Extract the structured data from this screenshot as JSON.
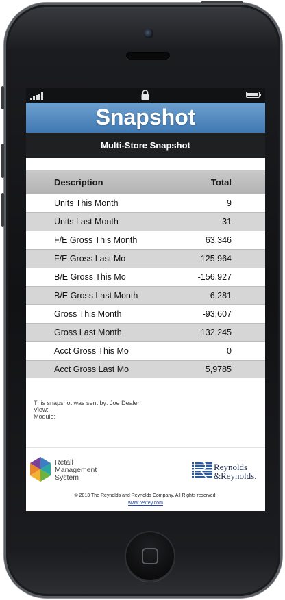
{
  "header": {
    "title": "Snapshot",
    "subtitle": "Multi-Store Snapshot"
  },
  "table": {
    "columns": [
      "Description",
      "Total"
    ],
    "rows": [
      {
        "description": "Units This Month",
        "total": "9"
      },
      {
        "description": "Units Last Month",
        "total": "31"
      },
      {
        "description": "F/E Gross This Month",
        "total": "63,346"
      },
      {
        "description": "F/E Gross Last Mo",
        "total": "125,964"
      },
      {
        "description": "B/E Gross This Mo",
        "total": "-156,927"
      },
      {
        "description": "B/E Gross Last Month",
        "total": "6,281"
      },
      {
        "description": "Gross This Month",
        "total": "-93,607"
      },
      {
        "description": "Gross Last Month",
        "total": "132,245"
      },
      {
        "description": "Acct Gross This Mo",
        "total": "0"
      },
      {
        "description": "Acct Gross Last Mo",
        "total": "5,9785"
      }
    ]
  },
  "footer": {
    "sent_by": "This snapshot was sent by: Joe Dealer",
    "view_label": "View:",
    "module_label": "Module:",
    "rms_line1": "Retail",
    "rms_line2": "Management",
    "rms_line3": "System",
    "rr_line1": "Reynolds",
    "rr_line2": "&Reynolds.",
    "copyright": "© 2013 The Reynolds and Reynolds Company. All Rights reserved.",
    "site": "www.reyrey.com"
  },
  "icons": {
    "signal": "signal-bars-icon",
    "lock": "lock-icon",
    "battery": "battery-icon"
  },
  "colors": {
    "header_blue": "#3f78b2",
    "subheader_dark": "#1f2021",
    "row_stripe": "#d6d6d6"
  }
}
